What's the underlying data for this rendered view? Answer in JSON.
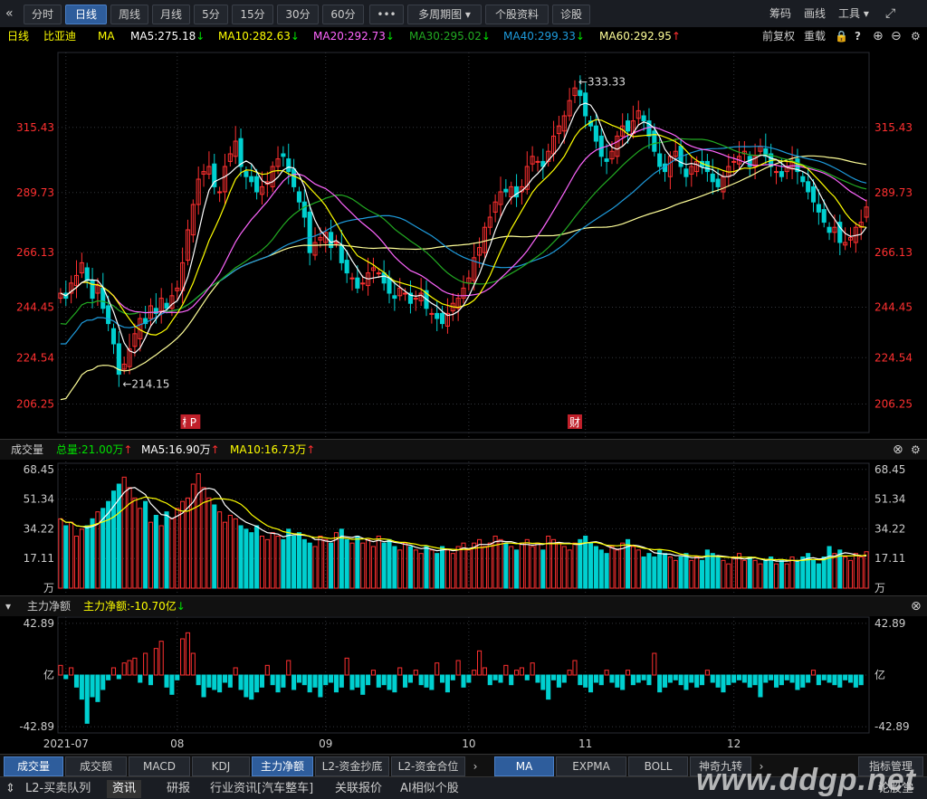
{
  "toolbar": {
    "collapse_icon": "double-chevron-left-icon",
    "periods": [
      "分时",
      "日线",
      "周线",
      "月线",
      "5分",
      "15分",
      "30分",
      "60分"
    ],
    "active_period": "日线",
    "more": "•••",
    "multi_period": "多周期图",
    "stock_info": "个股资料",
    "diagnose": "诊股",
    "right": [
      "筹码",
      "画线",
      "工具"
    ],
    "expand_icon": "expand-icon"
  },
  "ma_line": {
    "period": "日线",
    "stock": "比亚迪",
    "label": "MA",
    "items": [
      {
        "text": "MA5:275.18",
        "arrow": "↓",
        "color": "#ffffff",
        "arrow_color": "#00e000"
      },
      {
        "text": "MA10:282.63",
        "arrow": "↓",
        "color": "#ffff00",
        "arrow_color": "#00e000"
      },
      {
        "text": "MA20:292.73",
        "arrow": "↓",
        "color": "#ff66ff",
        "arrow_color": "#00e000"
      },
      {
        "text": "MA30:295.02",
        "arrow": "↓",
        "color": "#22aa22",
        "arrow_color": "#00e000"
      },
      {
        "text": "MA40:299.33",
        "arrow": "↓",
        "color": "#1e9bdc",
        "arrow_color": "#00e000"
      },
      {
        "text": "MA60:292.95",
        "arrow": "↑",
        "color": "#ffff99",
        "arrow_color": "#ff3030"
      }
    ],
    "right": [
      "前复权",
      "重载"
    ]
  },
  "colors": {
    "up": "#ff3030",
    "down": "#00d0d0",
    "ma5": "#ffffff",
    "ma10": "#ffff00",
    "ma20": "#ff66ff",
    "ma30": "#22aa22",
    "ma40": "#1e9bdc",
    "ma60": "#ffff99",
    "axis_text": "#ff3030",
    "grid": "#33363c"
  },
  "chart_data": [
    {
      "type": "candlestick",
      "ylim": [
        195,
        345
      ],
      "y_ticks": [
        "315.43",
        "289.73",
        "266.13",
        "244.45",
        "224.54",
        "206.25"
      ],
      "y_tick_values": [
        315.43,
        289.73,
        266.13,
        244.45,
        224.54,
        206.25
      ],
      "annotations": [
        {
          "text": "←333.33",
          "value": 333.33,
          "index": 97
        },
        {
          "text": "←214.15",
          "value": 214.15,
          "index": 11
        }
      ],
      "markers": [
        {
          "text": "榜",
          "index": 24
        },
        {
          "text": "P",
          "index": 25
        },
        {
          "text": "财",
          "index": 97
        }
      ],
      "x_labels": [
        {
          "text": "2021-07",
          "index": 1
        },
        {
          "text": "08",
          "index": 22
        },
        {
          "text": "09",
          "index": 50
        },
        {
          "text": "10",
          "index": 77
        },
        {
          "text": "11",
          "index": 99
        },
        {
          "text": "12",
          "index": 127
        }
      ],
      "closes": [
        250,
        248,
        254,
        257,
        262,
        255,
        248,
        253,
        244,
        238,
        230,
        218,
        222,
        228,
        234,
        240,
        238,
        245,
        242,
        248,
        244,
        249,
        252,
        262,
        275,
        285,
        295,
        298,
        300,
        292,
        290,
        300,
        305,
        310,
        300,
        296,
        294,
        290,
        292,
        294,
        300,
        303,
        304,
        298,
        292,
        286,
        280,
        266,
        270,
        272,
        274,
        268,
        270,
        262,
        258,
        256,
        252,
        254,
        258,
        260,
        258,
        254,
        250,
        248,
        252,
        250,
        246,
        248,
        250,
        244,
        242,
        240,
        238,
        242,
        246,
        248,
        252,
        256,
        264,
        268,
        276,
        280,
        286,
        290,
        290,
        292,
        288,
        292,
        300,
        304,
        302,
        300,
        306,
        312,
        316,
        320,
        326,
        331,
        328,
        320,
        316,
        310,
        304,
        302,
        306,
        312,
        316,
        314,
        318,
        322,
        318,
        312,
        306,
        300,
        298,
        304,
        306,
        300,
        296,
        300,
        302,
        300,
        298,
        294,
        292,
        296,
        300,
        302,
        304,
        306,
        300,
        304,
        308,
        304,
        300,
        298,
        296,
        300,
        302,
        298,
        294,
        290,
        286,
        282,
        278,
        274,
        276,
        270,
        270,
        272,
        276,
        278,
        284
      ],
      "volume": {
        "ylim": [
          0,
          72
        ],
        "y_ticks": [
          "68.45",
          "51.34",
          "34.22",
          "17.11",
          "万"
        ],
        "y_tick_values": [
          68.45,
          51.34,
          34.22,
          17.11,
          0
        ],
        "values": [
          40,
          36,
          38,
          30,
          34,
          36,
          40,
          44,
          46,
          50,
          56,
          60,
          64,
          58,
          52,
          46,
          50,
          38,
          42,
          36,
          44,
          40,
          46,
          50,
          52,
          60,
          66,
          58,
          52,
          48,
          44,
          38,
          42,
          40,
          36,
          34,
          32,
          36,
          30,
          28,
          32,
          30,
          28,
          34,
          30,
          32,
          28,
          26,
          24,
          30,
          28,
          26,
          32,
          34,
          28,
          26,
          30,
          26,
          28,
          24,
          30,
          26,
          28,
          24,
          22,
          26,
          24,
          22,
          20,
          24,
          22,
          20,
          24,
          22,
          20,
          24,
          26,
          22,
          26,
          28,
          24,
          26,
          30,
          28,
          26,
          24,
          22,
          26,
          28,
          24,
          26,
          22,
          30,
          28,
          26,
          24,
          22,
          26,
          28,
          30,
          26,
          24,
          22,
          20,
          24,
          22,
          26,
          28,
          24,
          22,
          18,
          20,
          18,
          22,
          20,
          18,
          16,
          18,
          20,
          16,
          18,
          16,
          22,
          20,
          18,
          16,
          14,
          18,
          20,
          16,
          18,
          16,
          14,
          16,
          18,
          14,
          16,
          14,
          18,
          16,
          18,
          20,
          16,
          14,
          18,
          24,
          20,
          22,
          18,
          16,
          20,
          18,
          21
        ],
        "ma5_label": "MA5:16.90万",
        "ma10_label": "MA10:16.73万",
        "total_label": "总量:21.00万"
      },
      "money_flow": {
        "ylim": [
          -48,
          48
        ],
        "y_ticks": [
          "42.89",
          "亿",
          "-42.89"
        ],
        "y_tick_values": [
          42.89,
          0,
          -42.89
        ],
        "values": [
          8,
          -3,
          6,
          -10,
          -20,
          -40,
          -18,
          -22,
          -12,
          -4,
          6,
          -3,
          10,
          12,
          14,
          -6,
          18,
          -8,
          22,
          28,
          -10,
          -16,
          -4,
          30,
          35,
          18,
          -8,
          -18,
          -10,
          -12,
          -14,
          -6,
          -10,
          6,
          -12,
          -18,
          -20,
          -14,
          -10,
          8,
          -8,
          -14,
          -10,
          12,
          -12,
          -6,
          -8,
          -14,
          -10,
          -18,
          -8,
          -6,
          -14,
          -10,
          14,
          -12,
          -10,
          -16,
          -8,
          4,
          -10,
          -8,
          -12,
          -14,
          6,
          -10,
          -6,
          4,
          -8,
          -10,
          -12,
          10,
          -6,
          -14,
          -4,
          12,
          -10,
          -6,
          4,
          20,
          6,
          -8,
          -4,
          -6,
          8,
          -8,
          4,
          6,
          -4,
          10,
          -6,
          -12,
          -20,
          -4,
          -10,
          -6,
          4,
          12,
          -8,
          -10,
          -14,
          -6,
          -8,
          4,
          -6,
          -10,
          -12,
          4,
          -8,
          -6,
          -4,
          -8,
          18,
          -14,
          -10,
          -6,
          -4,
          -8,
          -12,
          -6,
          -10,
          -8,
          4,
          -6,
          -10,
          -14,
          -8,
          -6,
          -4,
          -6,
          -10,
          -8,
          -18,
          -6,
          -4,
          -10,
          -8,
          -4,
          -6,
          -12,
          -10,
          -6,
          4,
          -8,
          -4,
          -6,
          -8,
          -10,
          -4,
          -6,
          -10,
          -8
        ],
        "label": "主力净额",
        "value_label": "主力净额:-10.70亿"
      }
    }
  ],
  "vol_panel": {
    "title": "成交量",
    "close_icon": "close-circle-icon",
    "gear_icon": "gear-icon"
  },
  "mf_panel": {
    "title": "主力净额",
    "collapse_icon": "chevron-down-icon",
    "close_icon": "close-circle-icon"
  },
  "tabs1": {
    "left": [
      "成交量",
      "成交额",
      "MACD",
      "KDJ",
      "主力净额",
      "L2-资金抄底",
      "L2-资金合位"
    ],
    "active_left": "成交量",
    "selected_left": "主力净额",
    "right": [
      "MA",
      "EXPMA",
      "BOLL",
      "神奇九转"
    ],
    "active_right": "MA",
    "manage": "指标管理"
  },
  "tabs2": {
    "items": [
      "L2-买卖队列",
      "资讯",
      "研报",
      "行业资讯[汽车整车]",
      "关联报价",
      "AI相似个股"
    ],
    "active": "资讯",
    "right": "论股堂",
    "watermark": "www.ddgp.net"
  }
}
